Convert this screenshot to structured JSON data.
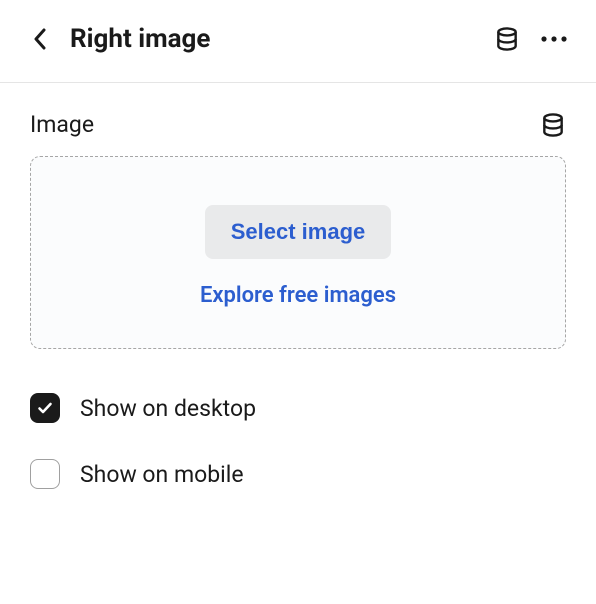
{
  "header": {
    "title": "Right image"
  },
  "image_section": {
    "label": "Image",
    "select_button_label": "Select image",
    "explore_link_label": "Explore free images"
  },
  "options": {
    "show_desktop": {
      "label": "Show on desktop",
      "checked": true
    },
    "show_mobile": {
      "label": "Show on mobile",
      "checked": false
    }
  }
}
